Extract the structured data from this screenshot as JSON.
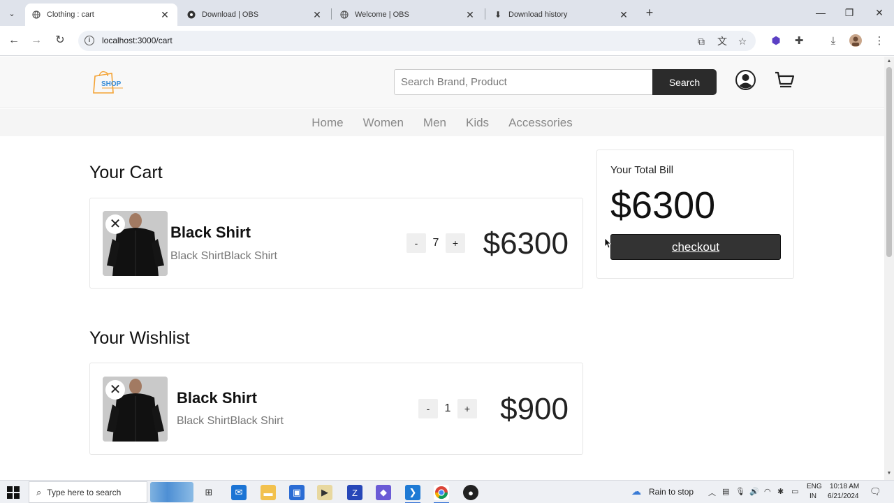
{
  "browser": {
    "tabs": [
      {
        "title": "Clothing : cart",
        "active": true
      },
      {
        "title": "Download | OBS",
        "active": false
      },
      {
        "title": "Welcome | OBS",
        "active": false
      },
      {
        "title": "Download history",
        "active": false
      }
    ],
    "new_tab": "+",
    "url": "localhost:3000/cart",
    "window_controls": {
      "minimize": "—",
      "maximize": "❐",
      "close": "✕"
    }
  },
  "header": {
    "search_placeholder": "Search Brand, Product",
    "search_button": "Search"
  },
  "nav": {
    "items": [
      "Home",
      "Women",
      "Men",
      "Kids",
      "Accessories"
    ]
  },
  "cart": {
    "title": "Your Cart",
    "items": [
      {
        "name": "Black Shirt",
        "description": "Black ShirtBlack Shirt",
        "quantity": "7",
        "price": "$6300",
        "minus": "-",
        "plus": "+"
      }
    ]
  },
  "wishlist": {
    "title": "Your Wishlist",
    "items": [
      {
        "name": "Black Shirt",
        "description": "Black ShirtBlack Shirt",
        "quantity": "1",
        "price": "$900",
        "minus": "-",
        "plus": "+"
      }
    ]
  },
  "bill": {
    "label": "Your Total Bill",
    "amount": "$6300",
    "checkout": "checkout"
  },
  "taskbar": {
    "search_placeholder": "Type here to search",
    "weather": "Rain to stop",
    "language_top": "ENG",
    "language_bottom": "IN",
    "time": "10:18 AM",
    "date": "6/21/2024"
  },
  "colors": {
    "accent_dark": "#2b2b2b",
    "nav_text": "#888888",
    "logo_orange": "#f4a233",
    "logo_blue": "#3b8ed6"
  }
}
